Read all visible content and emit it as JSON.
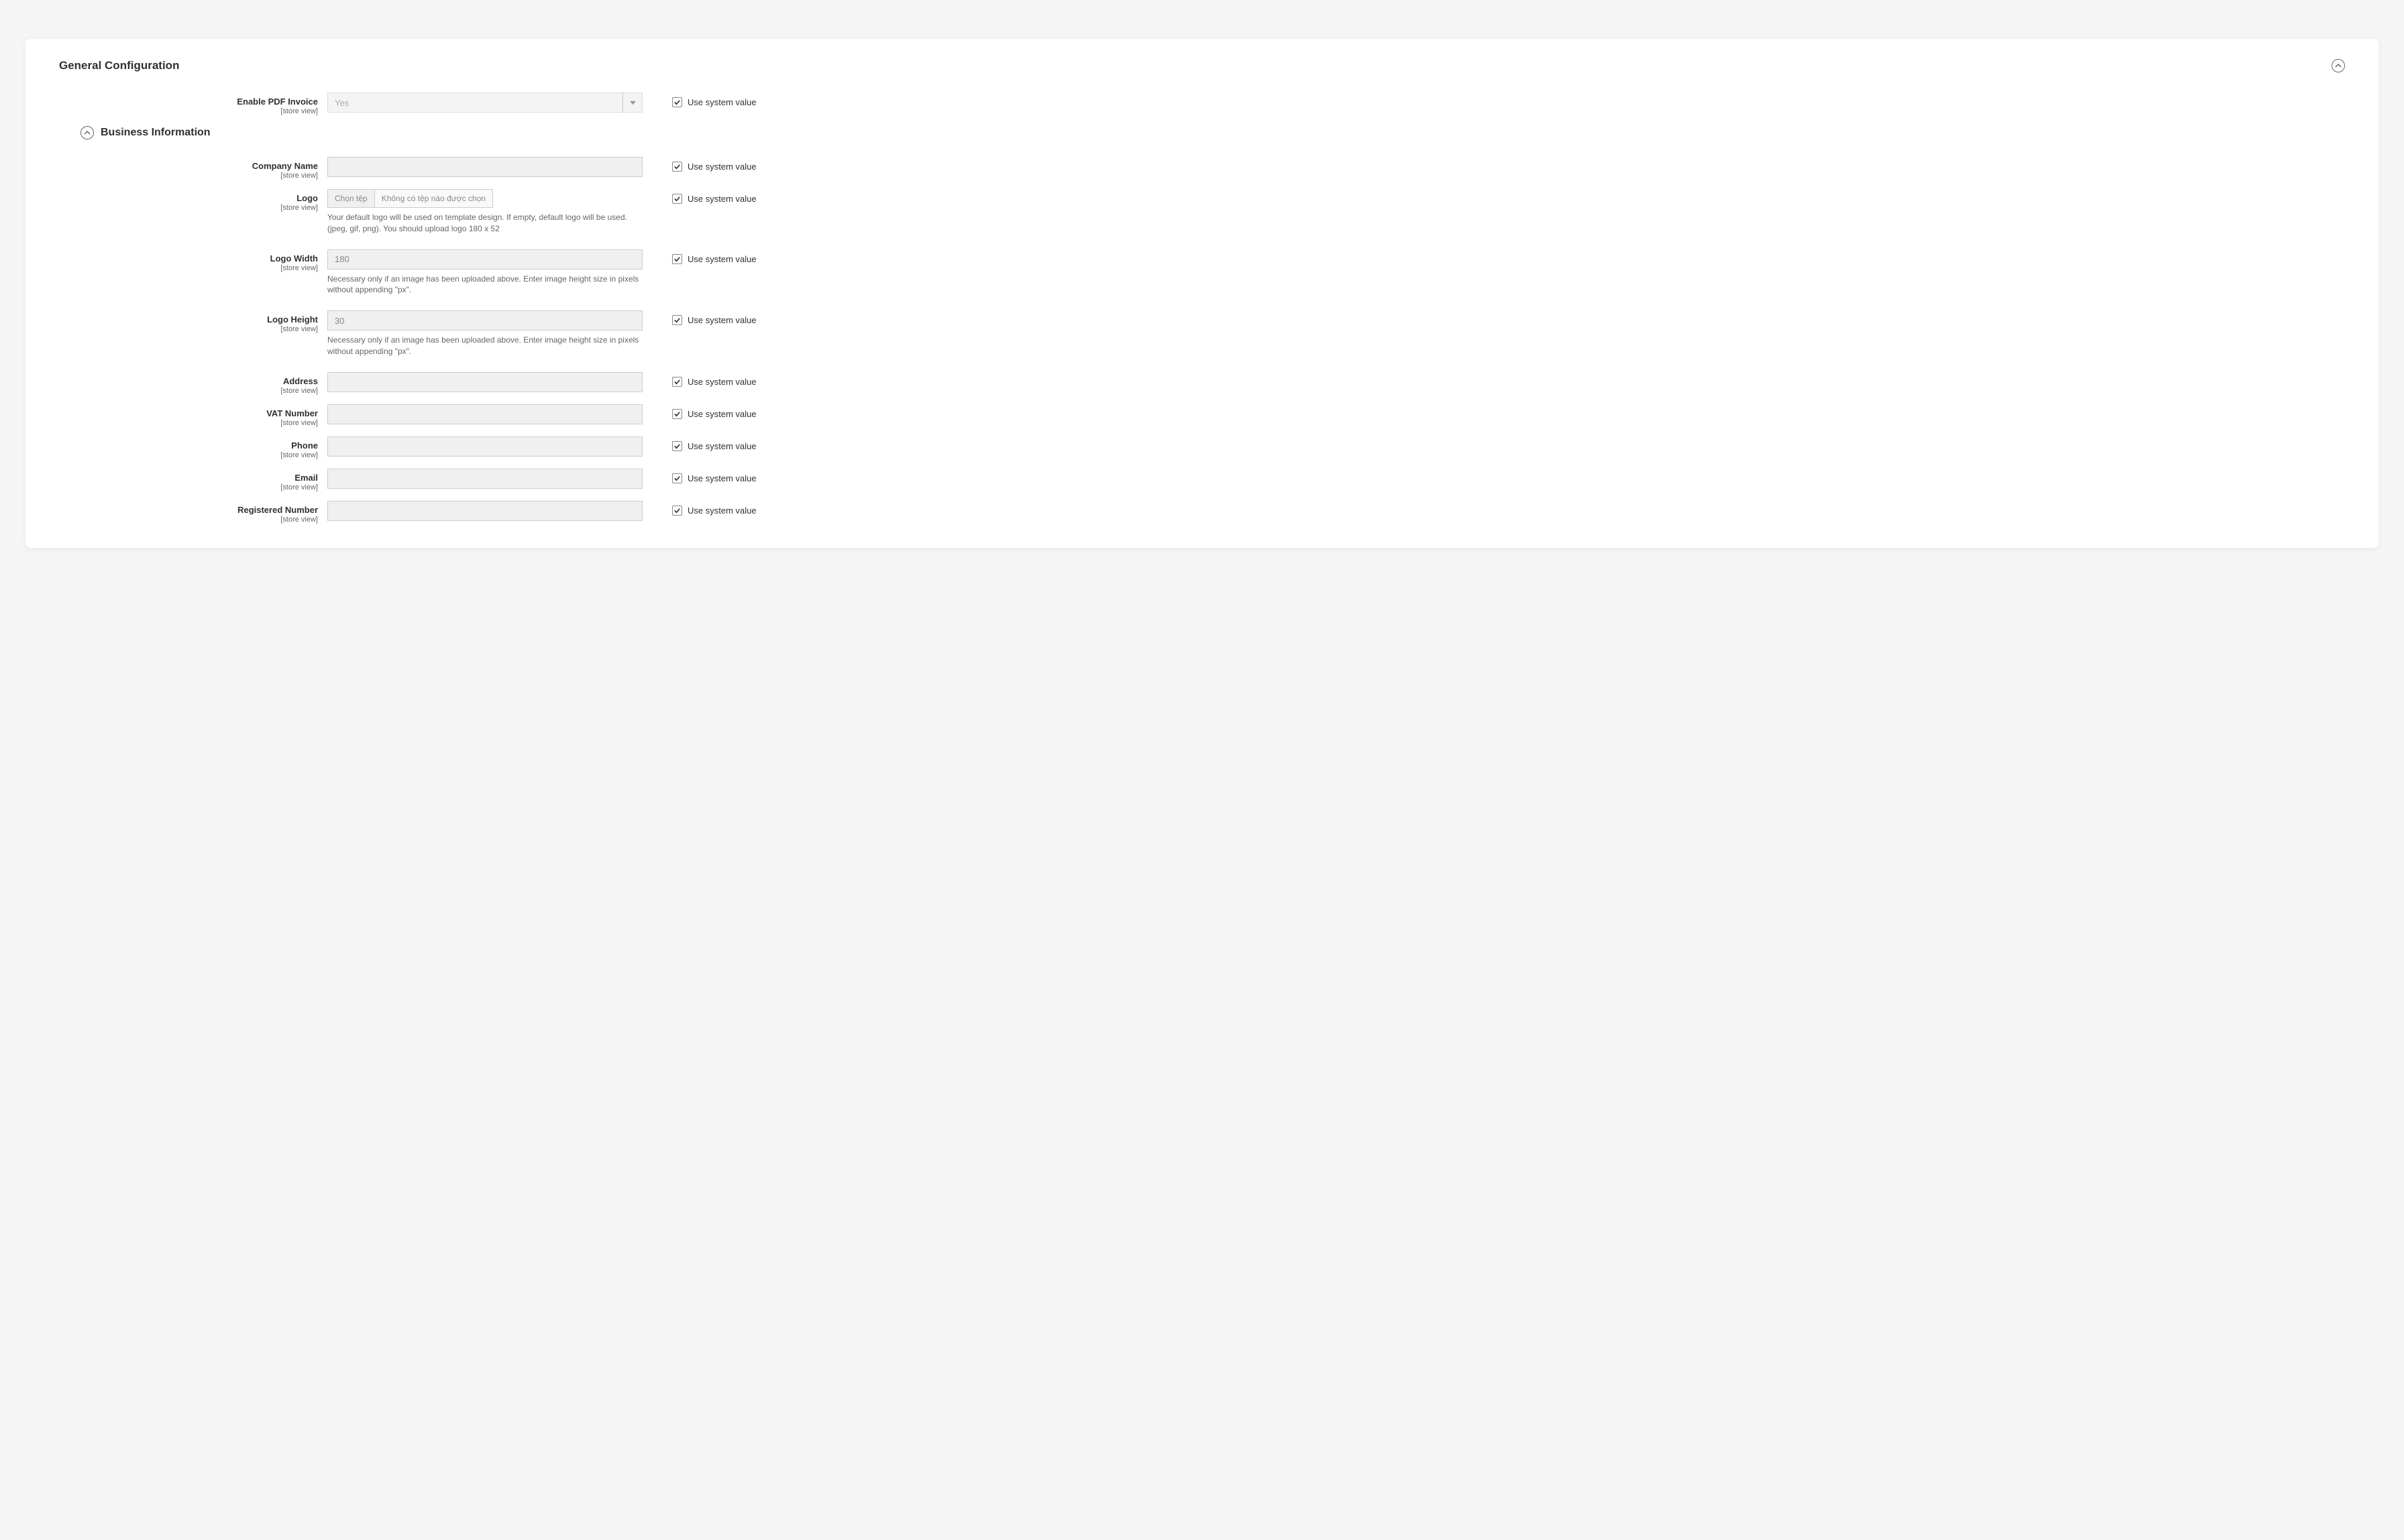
{
  "section": {
    "title": "General Configuration"
  },
  "subsection": {
    "title": "Business Information"
  },
  "common": {
    "scope": "[store view]",
    "use_system_value": "Use system value",
    "file_button": "Chọn tệp",
    "file_none": "Không có tệp nào được chọn"
  },
  "fields": {
    "enable": {
      "label": "Enable PDF Invoice",
      "value": "Yes"
    },
    "company_name": {
      "label": "Company Name",
      "value": ""
    },
    "logo": {
      "label": "Logo",
      "hint": "Your default logo will be used on template design. If empty, default logo will be used. (jpeg, gif, png). You should upload logo 180 x 52"
    },
    "logo_width": {
      "label": "Logo Width",
      "value": "180",
      "hint": "Necessary only if an image has been uploaded above. Enter image height size in pixels without appending \"px\"."
    },
    "logo_height": {
      "label": "Logo Height",
      "value": "30",
      "hint": "Necessary only if an image has been uploaded above. Enter image height size in pixels without appending \"px\"."
    },
    "address": {
      "label": "Address",
      "value": ""
    },
    "vat_number": {
      "label": "VAT Number",
      "value": ""
    },
    "phone": {
      "label": "Phone",
      "value": ""
    },
    "email": {
      "label": "Email",
      "value": ""
    },
    "registered_number": {
      "label": "Registered Number",
      "value": ""
    }
  }
}
